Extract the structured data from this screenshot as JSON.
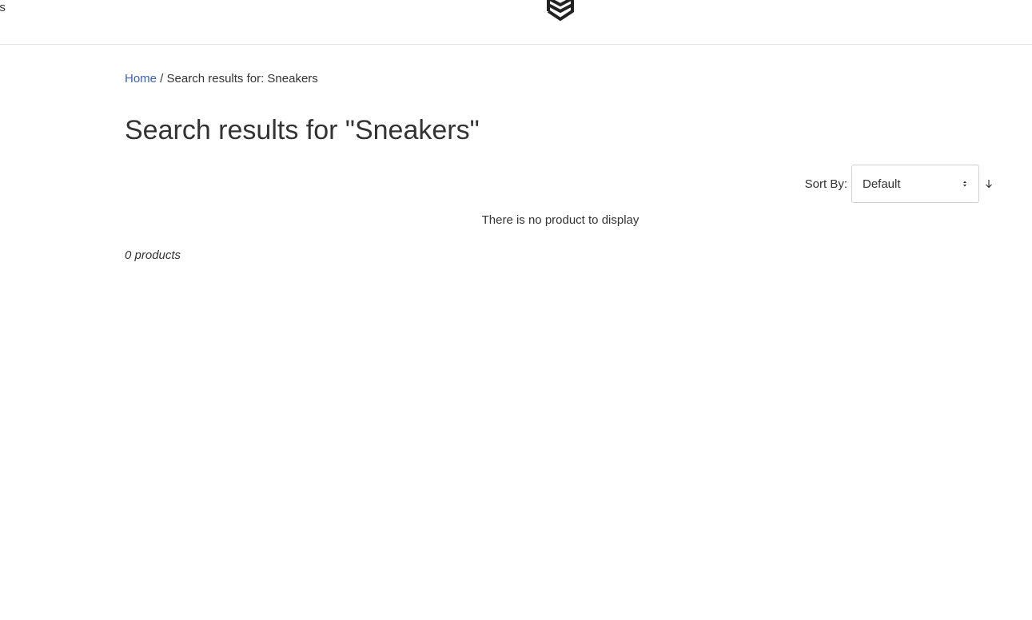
{
  "header": {
    "cut_link": "us",
    "logo_icon": "stacked-chevrons-logo"
  },
  "breadcrumb": {
    "home": "Home",
    "separator": " / ",
    "current": "Search results for: Sneakers"
  },
  "page": {
    "title": "Search results for \"Sneakers\""
  },
  "sort": {
    "label": "Sort By:",
    "selected": "Default",
    "direction_icon": "arrow-down-icon"
  },
  "results": {
    "empty_message": "There is no product to display",
    "count_text": "0 products"
  },
  "colors": {
    "link": "#3b5fc4",
    "text": "#333333",
    "border": "#cfcfcf"
  }
}
